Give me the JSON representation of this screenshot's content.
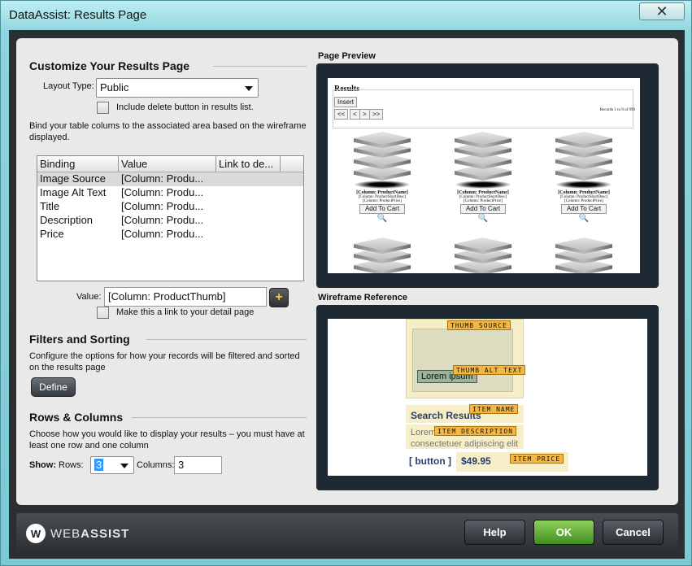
{
  "window": {
    "title": "DataAssist: Results Page",
    "close_glyph": "✕"
  },
  "customize": {
    "title": "Customize Your Results Page",
    "layout_type_label": "Layout Type:",
    "layout_type_value": "Public",
    "include_delete_label": "Include delete button in results list.",
    "bind_desc": "Bind your table colums to the associated area based on the wireframe displayed.",
    "grid": {
      "headers": [
        "Binding",
        "Value",
        "Link to de..."
      ],
      "rows": [
        {
          "binding": "Image Source",
          "value": "[Column: Produ..."
        },
        {
          "binding": "Image Alt Text",
          "value": "[Column: Produ..."
        },
        {
          "binding": "Title",
          "value": "[Column: Produ..."
        },
        {
          "binding": "Description",
          "value": "[Column: Produ..."
        },
        {
          "binding": "Price",
          "value": "[Column: Produ..."
        }
      ]
    },
    "value_label": "Value:",
    "value_text": "[Column: ProductThumb]",
    "plus_glyph": "+",
    "make_link_label": "Make this a link to your detail page"
  },
  "filters": {
    "title": "Filters and Sorting",
    "desc": "Configure the options for how your records will be filtered and sorted on the results page",
    "define_label": "Define"
  },
  "rows_columns": {
    "title": "Rows & Columns",
    "desc": "Choose how you would like to display your results – you must have at least one row and one column",
    "show_label": "Show:",
    "rows_label": "Rows:",
    "rows_value": "3",
    "columns_label": "Columns:",
    "columns_value": "3"
  },
  "preview": {
    "title": "Page Preview",
    "results_label": "Results",
    "insert_label": "Insert",
    "nav": [
      "<<",
      "<",
      ">",
      ">>"
    ],
    "records": "Records 1 to 9 of 999",
    "item": {
      "name": "[Column: ProductName]",
      "desc": "[Column: ProductShortDesc]",
      "price": "[Column: ProductPrice]",
      "cart": "Add To Cart",
      "zoom_glyph": "🔍"
    }
  },
  "wireframe": {
    "title": "Wireframe Reference",
    "tags": {
      "thumb_source": "THUMB SOURCE",
      "thumb_alt": "THUMB ALT TEXT",
      "item_name": "ITEM NAME",
      "item_desc": "ITEM DESCRIPTION",
      "item_price": "ITEM PRICE"
    },
    "lorem": "Lorem ipsum",
    "search_results": "Search Results",
    "lorem2": "Lorem",
    "lorem3": "consectetuer adipiscing elit",
    "button": "[ button ]",
    "price": "$49.95"
  },
  "footer": {
    "logo_mark": "W",
    "logo_text_light": "WEB",
    "logo_text_bold": "ASSIST",
    "help": "Help",
    "ok": "OK",
    "cancel": "Cancel"
  }
}
